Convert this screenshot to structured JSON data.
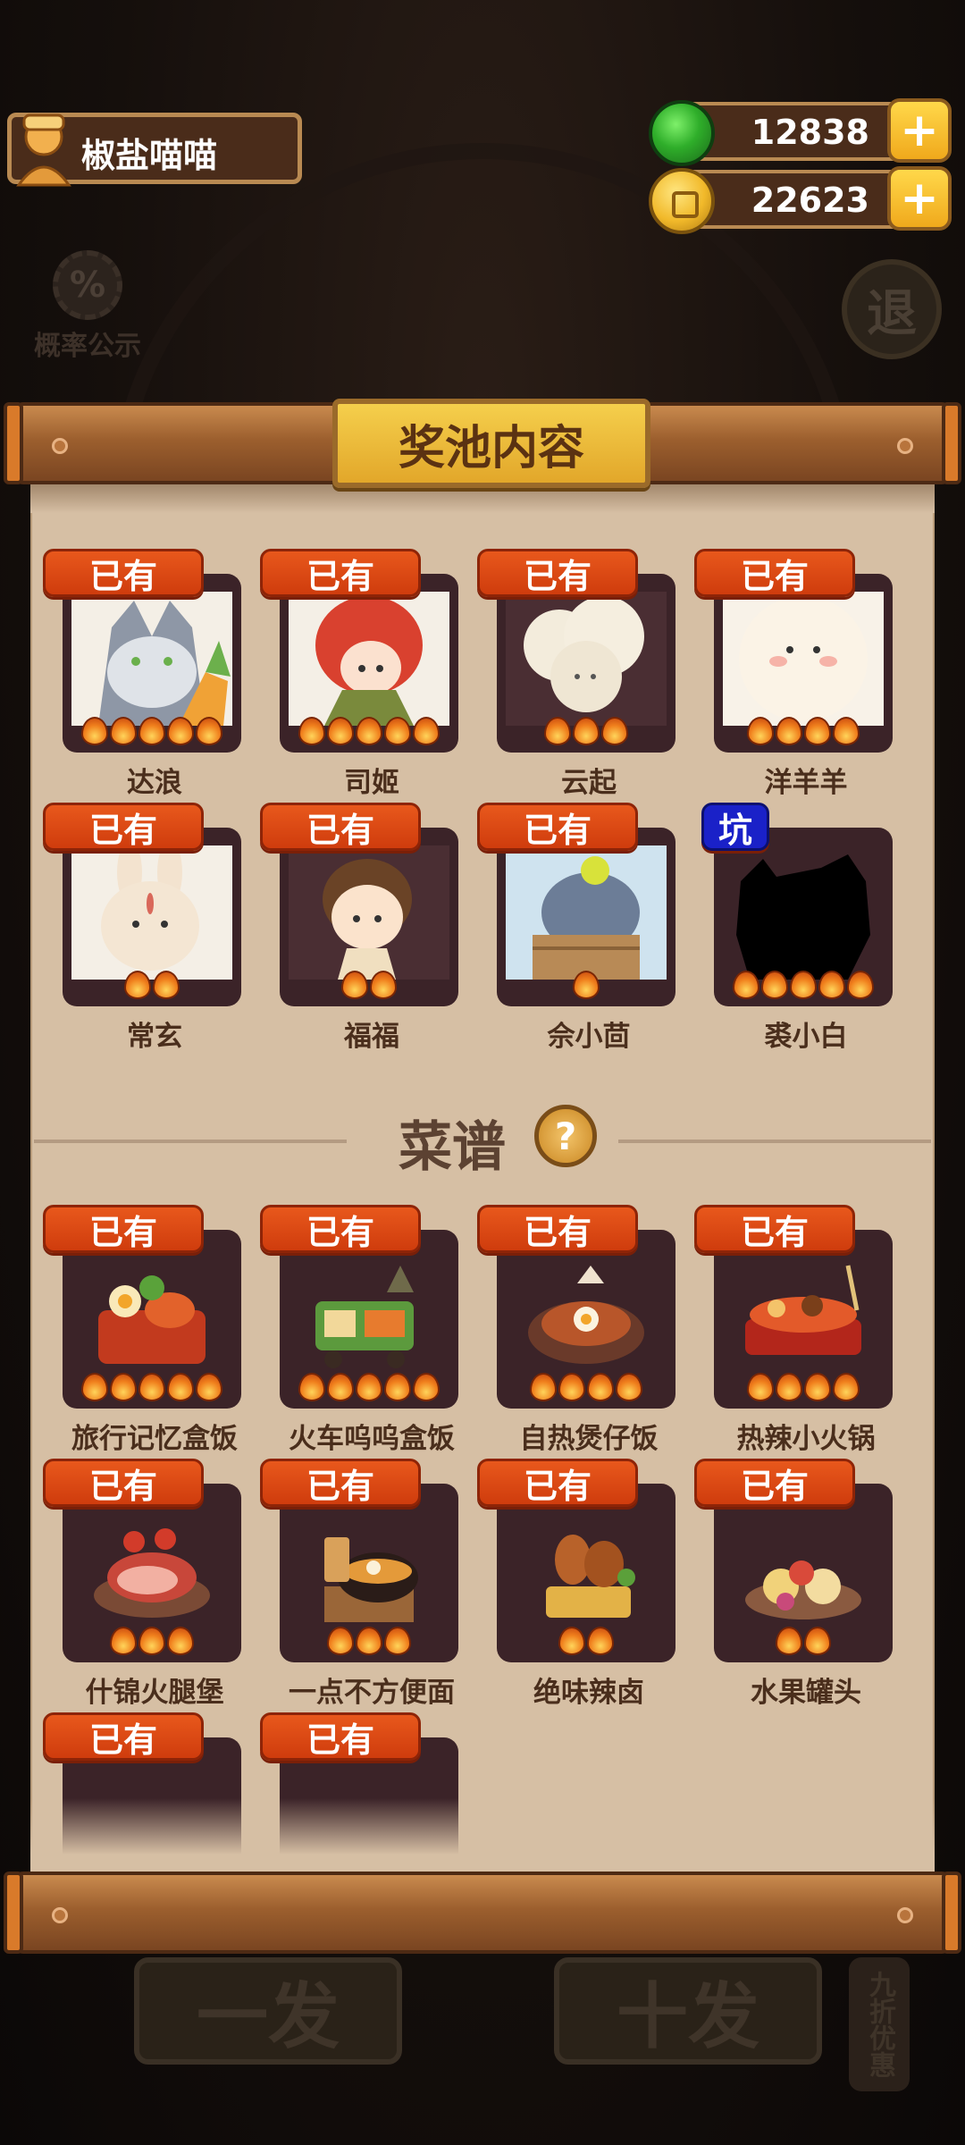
{
  "player": {
    "name": "椒盐喵喵"
  },
  "currency": {
    "gems": "12838",
    "coins": "22623"
  },
  "background": {
    "rate_label": "概率公示",
    "rate_symbol": "%",
    "exit_label": "退",
    "btn_single": "一发",
    "btn_ten": "十发",
    "discount": "九折优惠"
  },
  "panel": {
    "title": "奖池内容",
    "recipes_title": "菜谱",
    "help_symbol": "?"
  },
  "characters": [
    {
      "name": "达浪",
      "tag": "已有",
      "stars": 5
    },
    {
      "name": "司姬",
      "tag": "已有",
      "stars": 5
    },
    {
      "name": "云起",
      "tag": "已有",
      "stars": 3
    },
    {
      "name": "洋羊羊",
      "tag": "已有",
      "stars": 4
    },
    {
      "name": "常玄",
      "tag": "已有",
      "stars": 2
    },
    {
      "name": "福福",
      "tag": "已有",
      "stars": 2
    },
    {
      "name": "佘小茴",
      "tag": "已有",
      "stars": 1
    },
    {
      "name": "裘小白",
      "tag": "坑",
      "stars": 5
    }
  ],
  "recipes": [
    {
      "name": "旅行记忆盒饭",
      "tag": "已有",
      "stars": 5
    },
    {
      "name": "火车呜呜盒饭",
      "tag": "已有",
      "stars": 5
    },
    {
      "name": "自热煲仔饭",
      "tag": "已有",
      "stars": 4
    },
    {
      "name": "热辣小火锅",
      "tag": "已有",
      "stars": 4
    },
    {
      "name": "什锦火腿堡",
      "tag": "已有",
      "stars": 3
    },
    {
      "name": "一点不方便面",
      "tag": "已有",
      "stars": 3
    },
    {
      "name": "绝味辣卤",
      "tag": "已有",
      "stars": 2
    },
    {
      "name": "水果罐头",
      "tag": "已有",
      "stars": 2
    },
    {
      "name": "",
      "tag": "已有",
      "stars": 0
    },
    {
      "name": "",
      "tag": "已有",
      "stars": 0
    }
  ],
  "colors": {
    "tag_orange": "#d8440f",
    "tag_blue": "#1a21c8",
    "paper": "#d6bfa4"
  }
}
